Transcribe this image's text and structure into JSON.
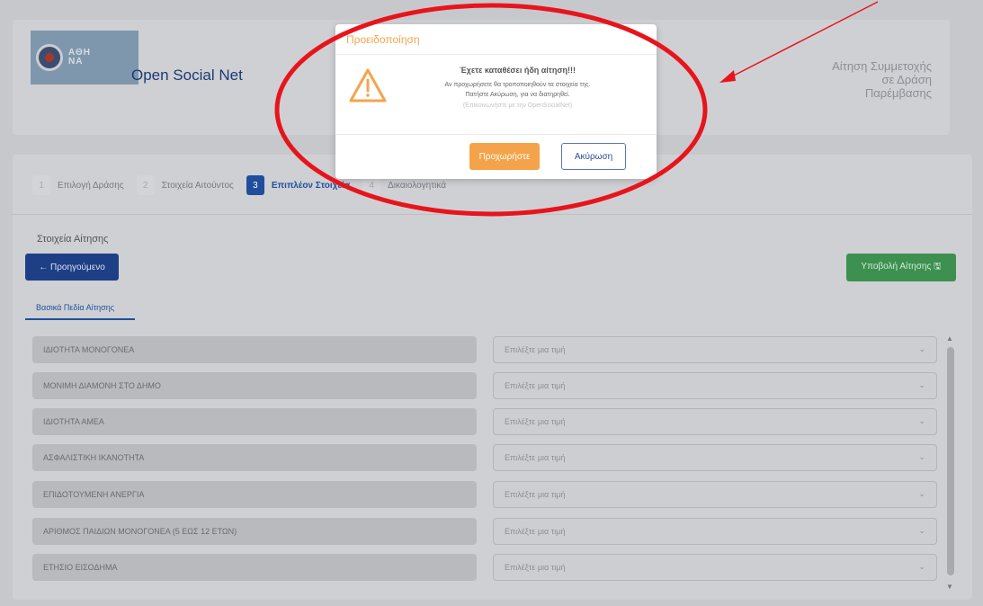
{
  "header": {
    "brand": "Open Social Net",
    "logo_text_1": "ΑΘΗ",
    "logo_text_2": "ΝΑ",
    "title_right": "Αίτηση Συμμετοχής σε Δράση Παρέμβασης"
  },
  "steps": [
    {
      "num": "1",
      "label": "Επιλογή Δράσης"
    },
    {
      "num": "2",
      "label": "Στοιχεία Αιτούντος"
    },
    {
      "num": "3",
      "label": "Επιπλέον Στοιχεία"
    },
    {
      "num": "4",
      "label": "Δικαιολογητικά"
    }
  ],
  "main": {
    "section_title": "Στοιχεία Αίτησης",
    "prev_button": "← Προηγούμενο",
    "submit_button": "Υποβολή Αίτησης 🖫",
    "tab_basic": "Βασικά Πεδία Αίτησης"
  },
  "rows": [
    {
      "label": "ΙΔΙΟΤΗΤΑ ΜΟΝΟΓΟΝΕΑ",
      "placeholder": "Επιλέξτε μια τιμή"
    },
    {
      "label": "ΜΟΝΙΜΗ ΔΙΑΜΟΝΗ ΣΤΟ ΔΗΜΟ",
      "placeholder": "Επιλέξτε μια τιμή"
    },
    {
      "label": "ΙΔΙΟΤΗΤΑ ΑΜΕΑ",
      "placeholder": "Επιλέξτε μια τιμή"
    },
    {
      "label": "ΑΣΦΑΛΙΣΤΙΚΗ ΙΚΑΝΟΤΗΤΑ",
      "placeholder": "Επιλέξτε μια τιμή"
    },
    {
      "label": "ΕΠΙΔΟΤΟΥΜΕΝΗ ΑΝΕΡΓΙΑ",
      "placeholder": "Επιλέξτε μια τιμή"
    },
    {
      "label": "ΑΡΙΘΜΟΣ ΠΑΙΔΙΩΝ ΜΟΝΟΓΟΝΕΑ (5 ΕΩΣ 12 ΕΤΩΝ)",
      "placeholder": "Επιλέξτε μια τιμή"
    },
    {
      "label": "ΕΤΗΣΙΟ ΕΙΣΟΔΗΜΑ",
      "placeholder": "Επιλέξτε μια τιμή"
    }
  ],
  "modal": {
    "title": "Προειδοποίηση",
    "heading": "Έχετε καταθέσει ήδη αίτηση!!!",
    "line1": "Αν προχωρήσετε θα τροποποιηθούν τα στοιχεία της.",
    "line2": "Πατήστε Ακύρωση, για να διατηρηθεί.",
    "note": "(Επικοινωνήστε με την OpenSocialNet)",
    "proceed_button": "Προχωρήστε",
    "cancel_button": "Ακύρωση"
  },
  "colors": {
    "annotation": "#e8141b",
    "warning": "#f3a44e",
    "primary": "#1e3f86",
    "success": "#3d9050"
  }
}
